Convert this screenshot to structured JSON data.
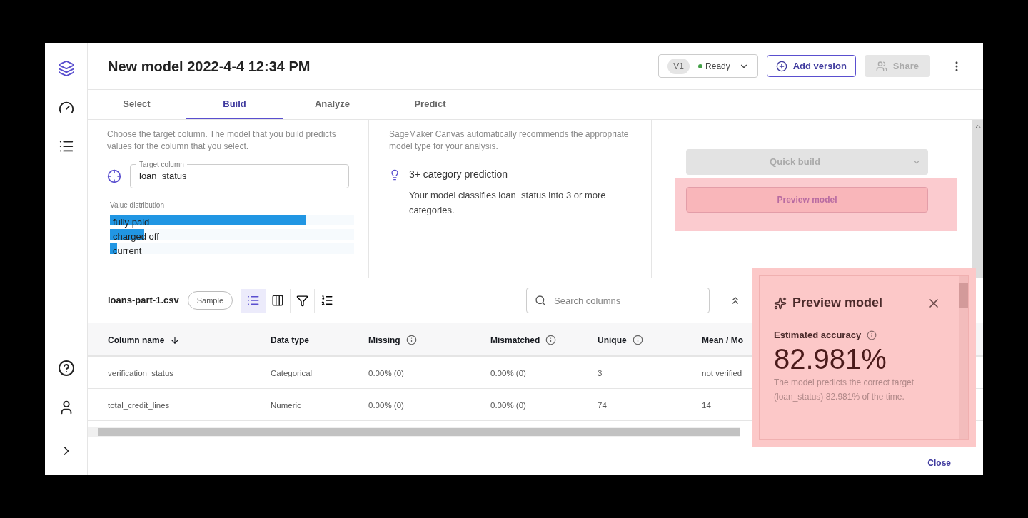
{
  "header": {
    "title": "New model 2022-4-4 12:34 PM",
    "version": {
      "badge": "V1",
      "status": "Ready"
    },
    "add_version": "Add version",
    "share": {
      "label": "Share",
      "disabled": true
    }
  },
  "tabs": [
    {
      "label": "Select",
      "selected": false
    },
    {
      "label": "Build",
      "selected": true
    },
    {
      "label": "Analyze",
      "selected": false
    },
    {
      "label": "Predict",
      "selected": false
    }
  ],
  "target": {
    "description": "Choose the target column. The model that you build predicts values for the column that you select.",
    "field_label": "Target column",
    "value": "loan_status",
    "distribution_label": "Value distribution",
    "distribution": [
      {
        "label": "fully paid",
        "level": 0.8
      },
      {
        "label": "charged off",
        "level": 0.14
      },
      {
        "label": "current",
        "level": 0.03
      }
    ]
  },
  "model_type": {
    "description": "SageMaker Canvas automatically recommends the appropriate model type for your analysis.",
    "type": "3+ category prediction",
    "explanation": "Your model classifies loan_status into 3 or more categories."
  },
  "actions": {
    "quick_build": {
      "label": "Quick build",
      "disabled": true
    },
    "preview": "Preview model"
  },
  "dataset": {
    "name": "loans-part-1.csv",
    "badge": "Sample",
    "list_view_selected": true,
    "search_placeholder": "Search columns"
  },
  "table": {
    "columns": [
      {
        "label": "Column name",
        "kind": "sorted"
      },
      {
        "label": "Data type",
        "kind": "plain"
      },
      {
        "label": "Missing",
        "kind": "info"
      },
      {
        "label": "Mismatched",
        "kind": "info"
      },
      {
        "label": "Unique",
        "kind": "info"
      },
      {
        "label": "Mean / Mo",
        "kind": "plain"
      }
    ],
    "rows": [
      [
        "verification_status",
        "Categorical",
        "0.00% (0)",
        "0.00% (0)",
        "3",
        "not verified"
      ],
      [
        "total_credit_lines",
        "Numeric",
        "0.00% (0)",
        "0.00% (0)",
        "74",
        "14"
      ]
    ]
  },
  "preview_panel": {
    "title": "Preview model",
    "metric_label": "Estimated accuracy",
    "metric": "82.981%",
    "note": "The model predicts the correct target (loan_status) 82.981% of the time."
  },
  "footer": {
    "close": "Close"
  }
}
